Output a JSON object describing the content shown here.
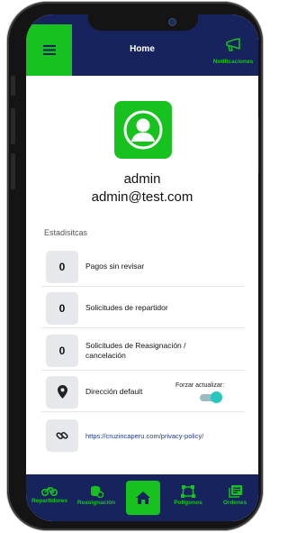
{
  "header": {
    "title": "Home",
    "notifications_label": "Notificaciones",
    "menu_icon": "hamburger-menu-icon",
    "notifications_icon": "megaphone-icon"
  },
  "profile": {
    "avatar_icon": "user-avatar-icon",
    "name": "admin",
    "email": "admin@test.com"
  },
  "stats": {
    "title": "Estadisitcas",
    "items": [
      {
        "value": "0",
        "label": "Pagos sin revisar"
      },
      {
        "value": "0",
        "label": "Solicitudes de repartidor"
      },
      {
        "value": "0",
        "label": "Solicitudes de Reasignación / cancelación"
      }
    ]
  },
  "address": {
    "icon": "location-pin-icon",
    "label": "Dirección default",
    "refresh_label": "Forzar actualizar:",
    "refresh_enabled": true
  },
  "privacy": {
    "icon": "link-icon",
    "url": "https://cruzincaperu.com/privacy-policy/"
  },
  "bottom_nav": {
    "items": [
      {
        "label": "Repartidores",
        "icon": "bicycle-icon"
      },
      {
        "label": "Reasignación",
        "icon": "coin-stack-icon"
      },
      {
        "label": "",
        "icon": "home-icon",
        "active": true
      },
      {
        "label": "Polígonos",
        "icon": "polygon-icon"
      },
      {
        "label": "Ordenes",
        "icon": "orders-icon"
      }
    ]
  },
  "colors": {
    "navy": "#16235d",
    "accent_green": "#17c21f",
    "tile_gray": "#e6e8ec",
    "toggle_on": "#27c7c1"
  }
}
